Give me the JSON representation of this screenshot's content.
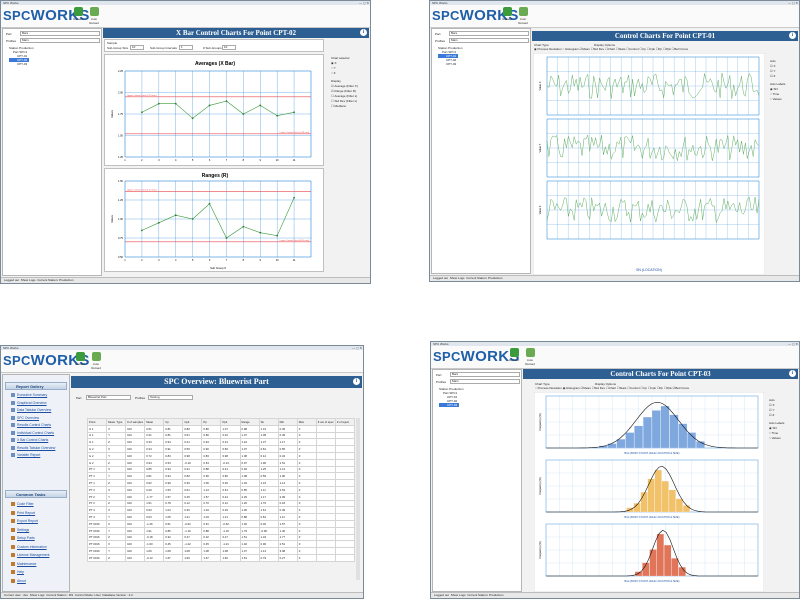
{
  "app": {
    "window_title": "SPC Works",
    "logo_prefix": "SPC",
    "logo_suffix": "WORKS",
    "reload": "Reload",
    "auto_reload": "Auto Reload"
  },
  "status": {
    "logged_out": "Logged out",
    "show_logs": "Show Logs",
    "current_station": "Current Station: Production",
    "current_user": "Current user : dev",
    "current_station_2": "Current Station : M3",
    "control_mode": "Control Mode: User",
    "db_version": "Database Version : 2.2"
  },
  "xbar": {
    "title": "X Bar Control Charts For Point CPT-02",
    "part_label": "Part",
    "part_value": "Bars",
    "profile_label": "Profiles",
    "profile_value": "Main",
    "tree": [
      "Station Production",
      "Part SPC1",
      "CPT-01",
      "CPT-02",
      "CPT-03"
    ],
    "sample_label": "Sample",
    "subgroup_size_label": "Sub-Group Size",
    "subgroup_size": "10",
    "subgroup_interval_label": "Sub-Group Intervals",
    "subgroup_interval": "1",
    "num_subgroups_label": "# Sub-Groups",
    "num_subgroups": "10",
    "chart_selector_label": "Chart selector",
    "axes": [
      "X",
      "Y",
      "Z"
    ],
    "display_label": "Display",
    "display_options": [
      "Average (Filter X)",
      "Range (Filter R)",
      "Average (Filter s)",
      "Std Dev (Filter s)",
      "Medians"
    ],
    "avg_chart_title": "Averages (X Bar)",
    "range_chart_title": "Ranges (R)",
    "y_label": "Values",
    "x_label": "Sub Group #",
    "avg_ucl": "Upper Control Limit (2.23 mm)",
    "avg_lcl": "Lower Control Limit (1.68 mm)",
    "range_ucl": "Upper Control Limit (1.42 mm)",
    "range_lcl": "Lower Control Limit (0.00 mm)",
    "avg_yticks": [
      "2.25",
      "2.00",
      "1.75",
      "1.50",
      "1.25"
    ],
    "range_yticks": [
      "1.50",
      "1.25",
      "1.00",
      "0.75",
      "0.50"
    ],
    "xticks": [
      "1",
      "2",
      "3",
      "4",
      "5",
      "6",
      "7",
      "8",
      "9",
      "10",
      "11"
    ]
  },
  "cpt01": {
    "title": "Control Charts For Point CPT-01",
    "part_value": "Bars",
    "profile_value": "Main",
    "tree": [
      "Station Production",
      "Part SPC1",
      "CPT-01",
      "CPT-02",
      "CPT-03"
    ],
    "chart_type_label": "Chart Type",
    "chart_types": [
      "Process Deviation",
      "Histogram"
    ],
    "display_options_label": "Display Options",
    "display_options": [
      "Mean",
      "Std Dev",
      "Chart",
      "Stats",
      "Control",
      "Cp",
      "Cpk",
      "Pp",
      "Ppk",
      "Bell Curve"
    ],
    "axis_label": "Axis",
    "axes": [
      "X",
      "Y",
      "Z"
    ],
    "axis_labels_label": "Axis Labels",
    "axis_label_options": [
      "SN",
      "Time",
      "Values"
    ],
    "panels": [
      "Value X",
      "Value Y",
      "Value Z"
    ],
    "x_axis_title": "SN (LOCATION)"
  },
  "overview": {
    "title": "SPC Overview: Bluewrist Part",
    "part_label": "Part",
    "part_value": "Bluewrist Part",
    "profile_label": "Profiles",
    "profile_value": "Testing",
    "report_gallery_label": "Report Gallery",
    "report_items": [
      "Executive Summary",
      "Graphical Overview",
      "Data Tabular Overview",
      "SPC Overview",
      "Results Control Charts",
      "Individual Control Charts",
      "X Bar Control Charts",
      "Results Tabular Overview",
      "Variable Report"
    ],
    "common_tasks_label": "Common Tasks",
    "task_items": [
      "Code Filter",
      "Print Report",
      "Export Report",
      "Settings",
      "Setup Parts",
      "Custom Information",
      "License Management",
      "Maintenance",
      "Help",
      "About"
    ],
    "columns": [
      "Point",
      "Meas. Type",
      "# of samples",
      "Mean",
      "Cp",
      "Cpk",
      "Pp",
      "Ppk",
      "Range",
      "Sk",
      "Min",
      "Max",
      "# out of spec",
      "# of reject"
    ],
    "rows": [
      [
        "G 1",
        "X",
        "100",
        "0.51",
        "0.81",
        "0.80",
        "0.80",
        "1.07",
        "0.98",
        "1.31",
        "0.45",
        "0"
      ],
      [
        "G 1",
        "Y",
        "100",
        "0.31",
        "0.81",
        "0.51",
        "0.80",
        "0.32",
        "1.07",
        "1.38",
        "0.49",
        "0"
      ],
      [
        "G 1",
        "Z",
        "100",
        "0.33",
        "0.94",
        "0.41",
        "0.94",
        "0.31",
        "1.44",
        "1.37",
        "1.17",
        "0"
      ],
      [
        "G 2",
        "X",
        "100",
        "0.34",
        "0.91",
        "0.50",
        "0.90",
        "0.50",
        "1.07",
        "0.81",
        "0.55",
        "0"
      ],
      [
        "G 2",
        "Y",
        "100",
        "0.72",
        "0.84",
        "0.98",
        "0.83",
        "0.98",
        "1.38",
        "0.12",
        "0.34",
        "0"
      ],
      [
        "G 2",
        "Z",
        "100",
        "0.94",
        "0.54",
        "-0.19",
        "0.54",
        "-0.13",
        "0.97",
        "1.96",
        "1.51",
        "0"
      ],
      [
        "PT 1",
        "X",
        "100",
        "0.85",
        "0.94",
        "0.31",
        "0.88",
        "0.31",
        "0.93",
        "1.25",
        "1.14",
        "0"
      ],
      [
        "PT 1",
        "Y",
        "100",
        "0.81",
        "0.94",
        "0.80",
        "0.90",
        "0.80",
        "1.08",
        "0.59",
        "1.00",
        "0"
      ],
      [
        "PT 1",
        "Z",
        "100",
        "0.62",
        "0.99",
        "0.30",
        "1.06",
        "0.30",
        "1.04",
        "1.16",
        "1.14",
        "0"
      ],
      [
        "PT 2",
        "X",
        "100",
        "0.29",
        "1.53",
        "0.61",
        "1.13",
        "0.61",
        "0.55",
        "1.11",
        "2.53",
        "0"
      ],
      [
        "PT 2",
        "Y",
        "100",
        "-1.77",
        "1.57",
        "0.45",
        "1.57",
        "0.44",
        "2.26",
        "1.17",
        "2.09",
        "0"
      ],
      [
        "PT 2",
        "Z",
        "100",
        "1.51",
        "0.78",
        "0.12",
        "0.70",
        "0.12",
        "1.20",
        "1.70",
        "0.18",
        "0"
      ],
      [
        "PT 4",
        "X",
        "100",
        "0.93",
        "1.04",
        "0.30",
        "1.04",
        "0.29",
        "1.00",
        "1.61",
        "0.39",
        "0"
      ],
      [
        "PT 4",
        "Y",
        "100",
        "0.63",
        "1.05",
        "1.21",
        "1.04",
        "1.21",
        "0.88",
        "0.81",
        "1.11",
        "0"
      ],
      [
        "PT 0016",
        "X",
        "100",
        "-1.26",
        "0.51",
        "-0.62",
        "0.51",
        "-0.62",
        "1.30",
        "0.02",
        "1.57",
        "0"
      ],
      [
        "PT 0016",
        "Y",
        "100",
        "1.91",
        "0.86",
        "-1.16",
        "0.88",
        "-1.16",
        "1.79",
        "-0.96",
        "1.40",
        "0"
      ],
      [
        "PT 0016",
        "Z",
        "100",
        "-0.18",
        "0.32",
        "0.27",
        "0.32",
        "0.27",
        "1.51",
        "1.34",
        "1.77",
        "0"
      ],
      [
        "PT 0016",
        "X",
        "100",
        "-1.63",
        "0.45",
        "-1.22",
        "0.45",
        "-1.21",
        "1.02",
        "0.00",
        "2.51",
        "0"
      ],
      [
        "PT 0016",
        "Y",
        "100",
        "1.66",
        "1.08",
        "1.08",
        "1.08",
        "1.08",
        "1.37",
        "1.14",
        "3.08",
        "0"
      ],
      [
        "PT 0016",
        "Z",
        "100",
        "-0.13",
        "1.67",
        "1.60",
        "1.67",
        "1.60",
        "1.51",
        "0.79",
        "0.27",
        "0"
      ]
    ]
  },
  "cpt03": {
    "title": "Control Charts For Point CPT-03",
    "part_value": "Bars",
    "profile_value": "Main",
    "tree": [
      "Station Production",
      "Part SPC1",
      "CPT-01",
      "CPT-02",
      "CPT-03"
    ],
    "chart_types": [
      "Process Deviation",
      "Histogram"
    ],
    "display_options": [
      "Mean",
      "Std Dev",
      "Chart",
      "Stats",
      "Control",
      "Cp",
      "Cpk",
      "Pp",
      "Ppk",
      "Bell Curve"
    ],
    "axes": [
      "X",
      "Y",
      "Z"
    ],
    "axis_label_options": [
      "SN",
      "Time",
      "Values"
    ],
    "panels": [
      "Bins (BODY FOUNT HOLE LOCATION & SIZE)",
      "Bins (BODY FOUNT HOLE LOCATION & SIZE)",
      "Bins (BODY FOUNT HOLE LOCATION & SIZE)"
    ],
    "y_label": "Frequency (%)",
    "hist_colors": [
      "#7fa8df",
      "#f2c26b",
      "#e0755a"
    ]
  },
  "colors": {
    "title_bar": "#2e5f92",
    "ucl": "#e8474c",
    "series": "#3a9a3a",
    "grid": "#1e7fd6"
  }
}
